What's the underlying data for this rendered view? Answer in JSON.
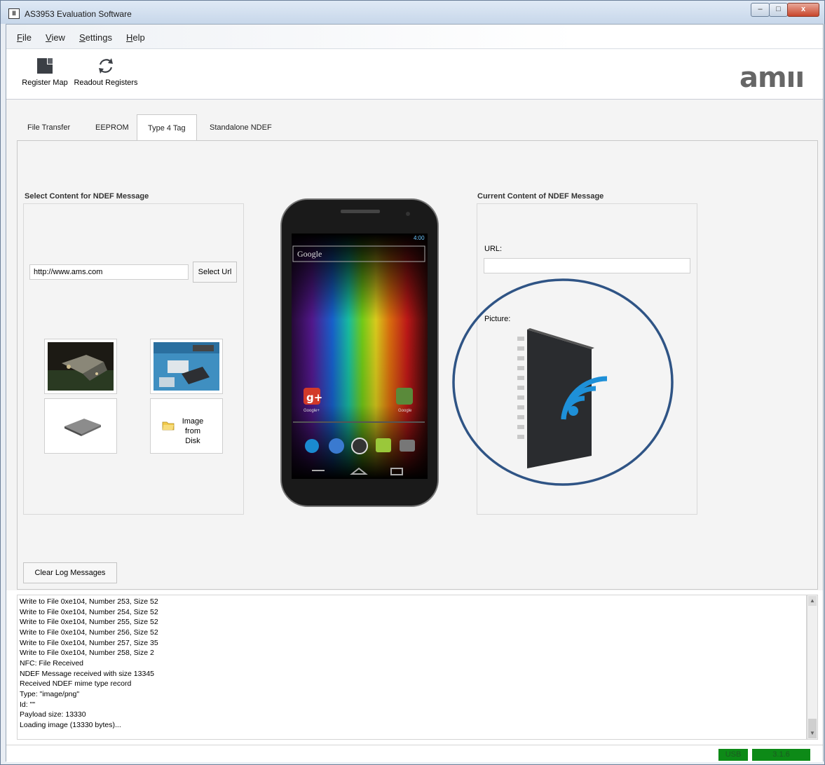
{
  "window": {
    "title": "AS3953 Evaluation Software",
    "minimize": "–",
    "maximize": "□",
    "close": "x"
  },
  "menu": {
    "file": {
      "accel": "F",
      "rest": "ile"
    },
    "view": {
      "accel": "V",
      "rest": "iew"
    },
    "settings": {
      "accel": "S",
      "rest": "ettings"
    },
    "help": {
      "accel": "H",
      "rest": "elp"
    }
  },
  "toolbar": {
    "register_map": "Register Map",
    "readout_registers": "Readout Registers",
    "logo": "amıı"
  },
  "tabs": [
    "File Transfer",
    "EEPROM",
    "Type 4 Tag",
    "Standalone NDEF"
  ],
  "active_tab": "Type 4 Tag",
  "left": {
    "title": "Select Content for NDEF Message",
    "url_value": "http://www.ams.com",
    "select_url": "Select Url",
    "image_from_disk_line1": "Image",
    "image_from_disk_line2": "from Disk"
  },
  "phone": {
    "status": "4:00",
    "search": "Google",
    "app1": "Google+",
    "app2": "Google"
  },
  "right": {
    "title": "Current Content of NDEF Message",
    "url_label": "URL:",
    "url_value": "",
    "picture_label": "Picture:"
  },
  "clear_log": "Clear Log Messages",
  "log": [
    "Write to File 0xe104, Number 253, Size 52",
    "Write to File 0xe104, Number 254, Size 52",
    "Write to File 0xe104, Number 255, Size 52",
    "Write to File 0xe104, Number 256, Size 52",
    "Write to File 0xe104, Number 257, Size 35",
    "Write to File 0xe104, Number 258, Size 2",
    "NFC: File Received",
    "NDEF Message received with size 13345",
    "Received NDEF mime type record",
    "Type: \"image/png\"",
    "Id: \"\"",
    "Payload size: 13330",
    "",
    "Loading image (13330 bytes)..."
  ],
  "status": {
    "usb": "USB",
    "version": "3.1.6"
  },
  "colors": {
    "status_green": "#0d8a17",
    "annotation_circle": "#2f5485",
    "nfc_blue": "#1e90d8"
  }
}
